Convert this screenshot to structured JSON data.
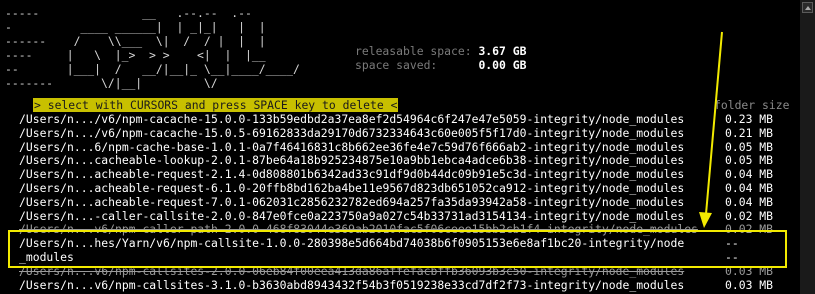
{
  "banner": {
    "ascii_art": "-----               __   .--.--  .--\n-          ____ ______|  | _|_|   |  |\n------    /    \\\\___  \\|  /  / |  |  |\n----     |   \\  |_>  > >    <|  |  |__\n--       |___|  /   __/|__|_ \\__|____/____/\n-------       \\/|__|         \\/"
  },
  "stats": {
    "releasable_label": "releasable space:",
    "releasable_value": "3.67 GB",
    "saved_label": "space saved:",
    "saved_value": "0.00 GB"
  },
  "prompt": "> select with CURSORS and press SPACE key to delete <",
  "folder_size_header": "folder size",
  "rows": [
    {
      "path": "/Users/n.../v6/npm-cacache-15.0.0-133b59edbd2a37ea8ef2d54964c6f247e47e5059-integrity/node_modules",
      "size": "0.23 MB"
    },
    {
      "path": "/Users/n.../v6/npm-cacache-15.0.5-69162833da29170d6732334643c60e005f5f17d0-integrity/node_modules",
      "size": "0.21 MB"
    },
    {
      "path": "/Users/n...6/npm-cache-base-1.0.1-0a7f46416831c8b662ee36fe4e7c59d76f666ab2-integrity/node_modules",
      "size": "0.05 MB"
    },
    {
      "path": "/Users/n...cacheable-lookup-2.0.1-87be64a18b925234875e10a9bb1ebca4adce6b38-integrity/node_modules",
      "size": "0.05 MB"
    },
    {
      "path": "/Users/n...acheable-request-2.1.4-0d808801b6342ad33c91df9d0b44dc09b91e5c3d-integrity/node_modules",
      "size": "0.04 MB"
    },
    {
      "path": "/Users/n...acheable-request-6.1.0-20ffb8bd162ba4be11e9567d823db651052ca912-integrity/node_modules",
      "size": "0.04 MB"
    },
    {
      "path": "/Users/n...acheable-request-7.0.1-062031c2856232782ed694a257fa35da93942a58-integrity/node_modules",
      "size": "0.04 MB"
    },
    {
      "path": "/Users/n...-caller-callsite-2.0.0-847e0fce0a223750a9a027c54b33731ad3154134-integrity/node_modules",
      "size": "0.02 MB"
    },
    {
      "path": "/Users/n...v6/npm-caller-path-2.0.0-468f83044e369ab2010fac5f06ceee15bb2cb1f4-integrity/node_modules",
      "size": "0.02 MB",
      "dim": true
    },
    {
      "path": "/Users/n...hes/Yarn/v6/npm-callsite-1.0.0-280398e5d664bd74038b6f0905153e6e8af1bc20-integrity/node",
      "size": "--"
    },
    {
      "path": "_modules",
      "size": "--",
      "cont": true
    },
    {
      "path": "/Users/n...v6/npm-callsites-2.0.0-06eb84f00eea413da86affefacbffb36093b3c50-integrity/node_modules",
      "size": "0.03 MB",
      "dim": true
    },
    {
      "path": "/Users/n...v6/npm-callsites-3.1.0-b3630abd8943432f54b3f0519238e33cd7df2f73-integrity/node_modules",
      "size": "0.03 MB"
    }
  ],
  "colors": {
    "prompt_bg": "#c8c000",
    "highlight_box": "#f2ea00",
    "arrow": "#f2ea00"
  }
}
